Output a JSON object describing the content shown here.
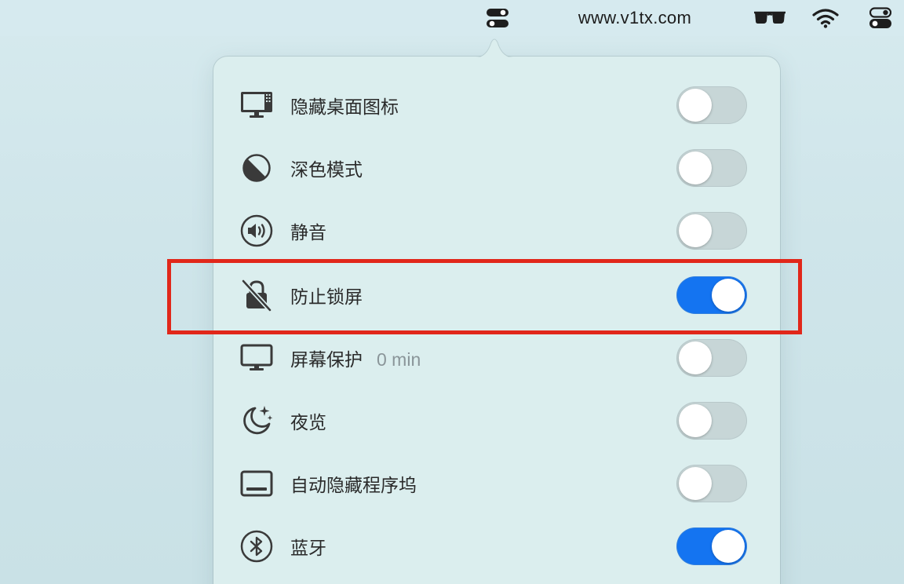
{
  "menubar": {
    "site_url": "www.v1tx.com"
  },
  "panel": {
    "items": [
      {
        "label": "隐藏桌面图标",
        "extra": "",
        "on": false,
        "icon": "desktop-icon"
      },
      {
        "label": "深色模式",
        "extra": "",
        "on": false,
        "icon": "dark-mode-icon"
      },
      {
        "label": "静音",
        "extra": "",
        "on": false,
        "icon": "speaker-icon"
      },
      {
        "label": "防止锁屏",
        "extra": "",
        "on": true,
        "icon": "lock-slash-icon"
      },
      {
        "label": "屏幕保护",
        "extra": "0 min",
        "on": false,
        "icon": "monitor-icon"
      },
      {
        "label": "夜览",
        "extra": "",
        "on": false,
        "icon": "moon-stars-icon"
      },
      {
        "label": "自动隐藏程序坞",
        "extra": "",
        "on": false,
        "icon": "dock-icon"
      },
      {
        "label": "蓝牙",
        "extra": "",
        "on": true,
        "icon": "bluetooth-icon"
      }
    ]
  },
  "colors": {
    "switch_on": "#1474f1",
    "switch_off": "#c7d6d7",
    "highlight": "#e1271a",
    "icon": "#3a3a3a"
  }
}
